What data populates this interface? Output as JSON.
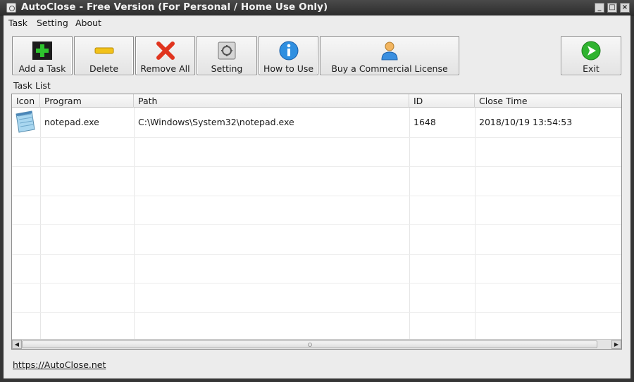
{
  "window": {
    "title": "AutoClose - Free Version (For Personal / Home Use Only)"
  },
  "menu": [
    "Task",
    "Setting",
    "About"
  ],
  "toolbar": {
    "add": "Add a Task",
    "delete": "Delete",
    "remove_all": "Remove All",
    "setting": "Setting",
    "how_to_use": "How to Use",
    "buy": "Buy a Commercial License",
    "exit": "Exit"
  },
  "task_list": {
    "label": "Task List",
    "columns": [
      "Icon",
      "Program",
      "Path",
      "ID",
      "Close Time"
    ],
    "rows": [
      {
        "icon": "notepad-icon",
        "program": "notepad.exe",
        "path": "C:\\Windows\\System32\\notepad.exe",
        "id": "1648",
        "close_time": "2018/10/19 13:54:53"
      }
    ]
  },
  "footer": {
    "link": "https://AutoClose.net"
  }
}
